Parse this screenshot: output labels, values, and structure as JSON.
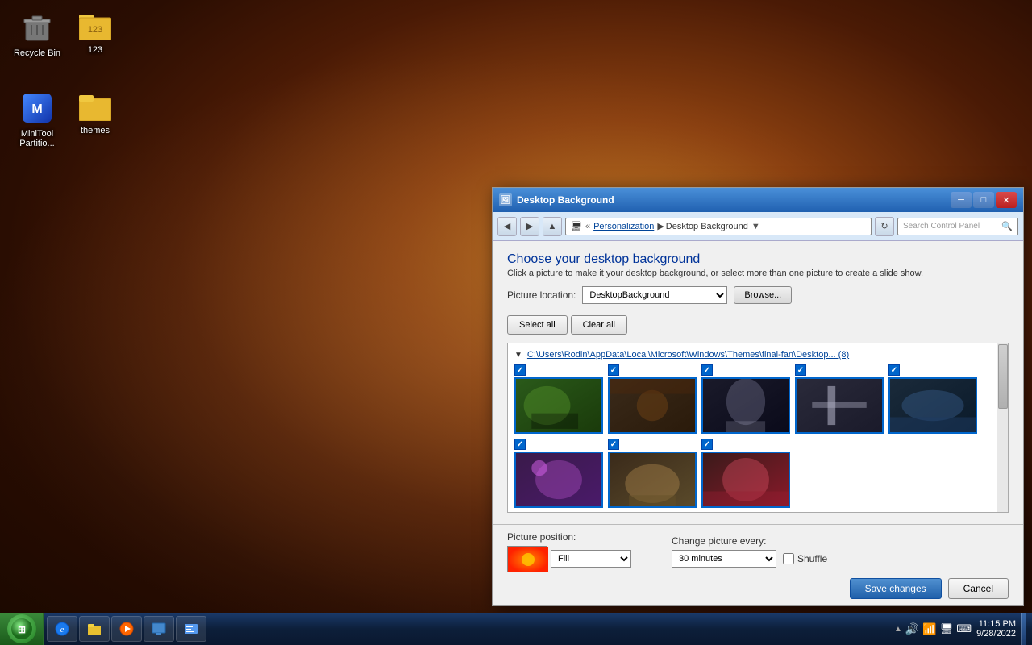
{
  "desktop": {
    "icons": [
      {
        "id": "recycle-bin",
        "label": "Recycle Bin",
        "type": "recycle"
      },
      {
        "id": "123",
        "label": "123",
        "type": "folder"
      },
      {
        "id": "minitool",
        "label": "MiniTool Partitio...",
        "type": "app"
      },
      {
        "id": "themes",
        "label": "themes",
        "type": "folder"
      }
    ]
  },
  "taskbar": {
    "time": "11:15 PM",
    "date": "9/28/2022",
    "items": [
      {
        "label": "🪟",
        "id": "start"
      },
      {
        "label": "🌐",
        "id": "ie"
      },
      {
        "label": "📁",
        "id": "explorer"
      },
      {
        "label": "▶",
        "id": "media"
      },
      {
        "label": "🖥",
        "id": "display"
      },
      {
        "label": "⚙",
        "id": "settings"
      }
    ]
  },
  "dialog": {
    "title": "Desktop Background",
    "title_bar_title": "Desktop Background",
    "address_bar": {
      "back_tooltip": "Back",
      "forward_tooltip": "Forward",
      "path_parts": [
        "Personalization",
        "Desktop Background"
      ],
      "search_placeholder": "Search Control Panel"
    },
    "content": {
      "heading": "Choose your desktop background",
      "subtitle": "Click a picture to make it your desktop background, or select more than one picture to create a slide show.",
      "picture_location_label": "Picture location:",
      "picture_location_value": "DesktopBackground",
      "browse_label": "Browse...",
      "select_all_label": "Select all",
      "clear_all_label": "Clear all",
      "group_path": "C:\\Users\\Rodin\\AppData\\Local\\Microsoft\\Windows\\Themes\\final-fan\\Desktop... (8)",
      "images": [
        {
          "id": 1,
          "checked": true,
          "thumb_class": "thumb-1"
        },
        {
          "id": 2,
          "checked": true,
          "thumb_class": "thumb-2"
        },
        {
          "id": 3,
          "checked": true,
          "thumb_class": "thumb-3"
        },
        {
          "id": 4,
          "checked": true,
          "thumb_class": "thumb-4"
        },
        {
          "id": 5,
          "checked": true,
          "thumb_class": "thumb-5"
        },
        {
          "id": 6,
          "checked": true,
          "thumb_class": "thumb-6"
        },
        {
          "id": 7,
          "checked": true,
          "thumb_class": "thumb-7"
        },
        {
          "id": 8,
          "checked": true,
          "thumb_class": "thumb-8"
        }
      ]
    },
    "bottom": {
      "picture_position_label": "Picture position:",
      "picture_position_value": "Fill",
      "change_picture_every_label": "Change picture every:",
      "change_picture_every_value": "30 minutes",
      "shuffle_label": "Shuffle",
      "shuffle_checked": false,
      "save_changes_label": "Save changes",
      "cancel_label": "Cancel"
    }
  }
}
